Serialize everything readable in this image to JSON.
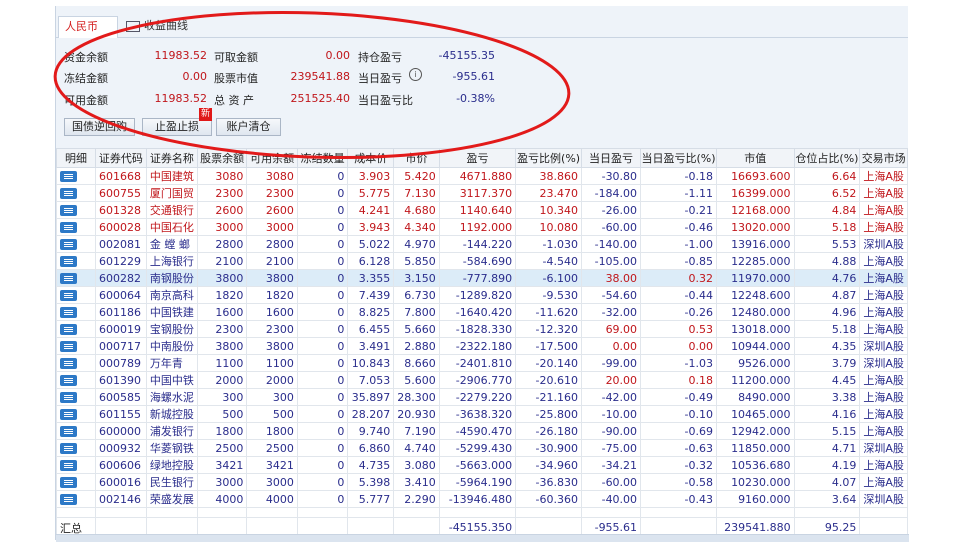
{
  "tabs": {
    "active": "人民币",
    "curve": "收益曲线"
  },
  "summary": {
    "fund_balance_label": "资金余额",
    "fund_balance": "11983.52",
    "withdrawable_label": "可取金额",
    "withdrawable": "0.00",
    "position_pnl_label": "持仓盈亏",
    "position_pnl": "-45155.35",
    "frozen_label": "冻结金额",
    "frozen": "0.00",
    "stock_value_label": "股票市值",
    "stock_value": "239541.88",
    "daily_pnl_label": "当日盈亏",
    "daily_pnl": "-955.61",
    "available_label": "可用金额",
    "available": "11983.52",
    "total_assets_label": "总 资 产",
    "total_assets": "251525.40",
    "daily_pnl_ratio_label": "当日盈亏比",
    "daily_pnl_ratio": "-0.38%"
  },
  "buttons": {
    "repo": "国债逆回购",
    "stop": "止盈止损",
    "new_badge": "新",
    "clear": "账户清仓"
  },
  "columns": [
    "明细",
    "证券代码",
    "证券名称",
    "股票余额",
    "可用余额",
    "冻结数量",
    "成本价",
    "市价",
    "盈亏",
    "盈亏比例(%)",
    "当日盈亏",
    "当日盈亏比(%)",
    "市值",
    "仓位占比(%)",
    "交易市场"
  ],
  "rows": [
    [
      "601668",
      "中国建筑",
      "3080",
      "3080",
      "0",
      "3.903",
      "5.420",
      "4671.880",
      "38.860",
      "-30.80",
      "-0.18",
      "16693.600",
      "6.64",
      "上海A股"
    ],
    [
      "600755",
      "厦门国贸",
      "2300",
      "2300",
      "0",
      "5.775",
      "7.130",
      "3117.370",
      "23.470",
      "-184.00",
      "-1.11",
      "16399.000",
      "6.52",
      "上海A股"
    ],
    [
      "601328",
      "交通银行",
      "2600",
      "2600",
      "0",
      "4.241",
      "4.680",
      "1140.640",
      "10.340",
      "-26.00",
      "-0.21",
      "12168.000",
      "4.84",
      "上海A股"
    ],
    [
      "600028",
      "中国石化",
      "3000",
      "3000",
      "0",
      "3.943",
      "4.340",
      "1192.000",
      "10.080",
      "-60.00",
      "-0.46",
      "13020.000",
      "5.18",
      "上海A股"
    ],
    [
      "002081",
      "金 螳 螂",
      "2800",
      "2800",
      "0",
      "5.022",
      "4.970",
      "-144.220",
      "-1.030",
      "-140.00",
      "-1.00",
      "13916.000",
      "5.53",
      "深圳A股"
    ],
    [
      "601229",
      "上海银行",
      "2100",
      "2100",
      "0",
      "6.128",
      "5.850",
      "-584.690",
      "-4.540",
      "-105.00",
      "-0.85",
      "12285.000",
      "4.88",
      "上海A股"
    ],
    [
      "600282",
      "南钢股份",
      "3800",
      "3800",
      "0",
      "3.355",
      "3.150",
      "-777.890",
      "-6.100",
      "38.00",
      "0.32",
      "11970.000",
      "4.76",
      "上海A股"
    ],
    [
      "600064",
      "南京高科",
      "1820",
      "1820",
      "0",
      "7.439",
      "6.730",
      "-1289.820",
      "-9.530",
      "-54.60",
      "-0.44",
      "12248.600",
      "4.87",
      "上海A股"
    ],
    [
      "601186",
      "中国铁建",
      "1600",
      "1600",
      "0",
      "8.825",
      "7.800",
      "-1640.420",
      "-11.620",
      "-32.00",
      "-0.26",
      "12480.000",
      "4.96",
      "上海A股"
    ],
    [
      "600019",
      "宝钢股份",
      "2300",
      "2300",
      "0",
      "6.455",
      "5.660",
      "-1828.330",
      "-12.320",
      "69.00",
      "0.53",
      "13018.000",
      "5.18",
      "上海A股"
    ],
    [
      "000717",
      "中南股份",
      "3800",
      "3800",
      "0",
      "3.491",
      "2.880",
      "-2322.180",
      "-17.500",
      "0.00",
      "0.00",
      "10944.000",
      "4.35",
      "深圳A股"
    ],
    [
      "000789",
      "万年青",
      "1100",
      "1100",
      "0",
      "10.843",
      "8.660",
      "-2401.810",
      "-20.140",
      "-99.00",
      "-1.03",
      "9526.000",
      "3.79",
      "深圳A股"
    ],
    [
      "601390",
      "中国中铁",
      "2000",
      "2000",
      "0",
      "7.053",
      "5.600",
      "-2906.770",
      "-20.610",
      "20.00",
      "0.18",
      "11200.000",
      "4.45",
      "上海A股"
    ],
    [
      "600585",
      "海螺水泥",
      "300",
      "300",
      "0",
      "35.897",
      "28.300",
      "-2279.220",
      "-21.160",
      "-42.00",
      "-0.49",
      "8490.000",
      "3.38",
      "上海A股"
    ],
    [
      "601155",
      "新城控股",
      "500",
      "500",
      "0",
      "28.207",
      "20.930",
      "-3638.320",
      "-25.800",
      "-10.00",
      "-0.10",
      "10465.000",
      "4.16",
      "上海A股"
    ],
    [
      "600000",
      "浦发银行",
      "1800",
      "1800",
      "0",
      "9.740",
      "7.190",
      "-4590.470",
      "-26.180",
      "-90.00",
      "-0.69",
      "12942.000",
      "5.15",
      "上海A股"
    ],
    [
      "000932",
      "华菱钢铁",
      "2500",
      "2500",
      "0",
      "6.860",
      "4.740",
      "-5299.430",
      "-30.900",
      "-75.00",
      "-0.63",
      "11850.000",
      "4.71",
      "深圳A股"
    ],
    [
      "600606",
      "绿地控股",
      "3421",
      "3421",
      "0",
      "4.735",
      "3.080",
      "-5663.000",
      "-34.960",
      "-34.21",
      "-0.32",
      "10536.680",
      "4.19",
      "上海A股"
    ],
    [
      "600016",
      "民生银行",
      "3000",
      "3000",
      "0",
      "5.398",
      "3.410",
      "-5964.190",
      "-36.830",
      "-60.00",
      "-0.58",
      "10230.000",
      "4.07",
      "上海A股"
    ],
    [
      "002146",
      "荣盛发展",
      "4000",
      "4000",
      "0",
      "5.777",
      "2.290",
      "-13946.480",
      "-60.360",
      "-40.00",
      "-0.43",
      "9160.000",
      "3.64",
      "深圳A股"
    ]
  ],
  "total": {
    "label": "汇总",
    "pnl": "-45155.350",
    "daily_pnl": "-955.61",
    "market_value": "239541.880",
    "position_ratio": "95.25"
  },
  "colors": {
    "red": "#c0161b",
    "blue": "#2a2d8c",
    "annotation": "#e21a1a"
  }
}
